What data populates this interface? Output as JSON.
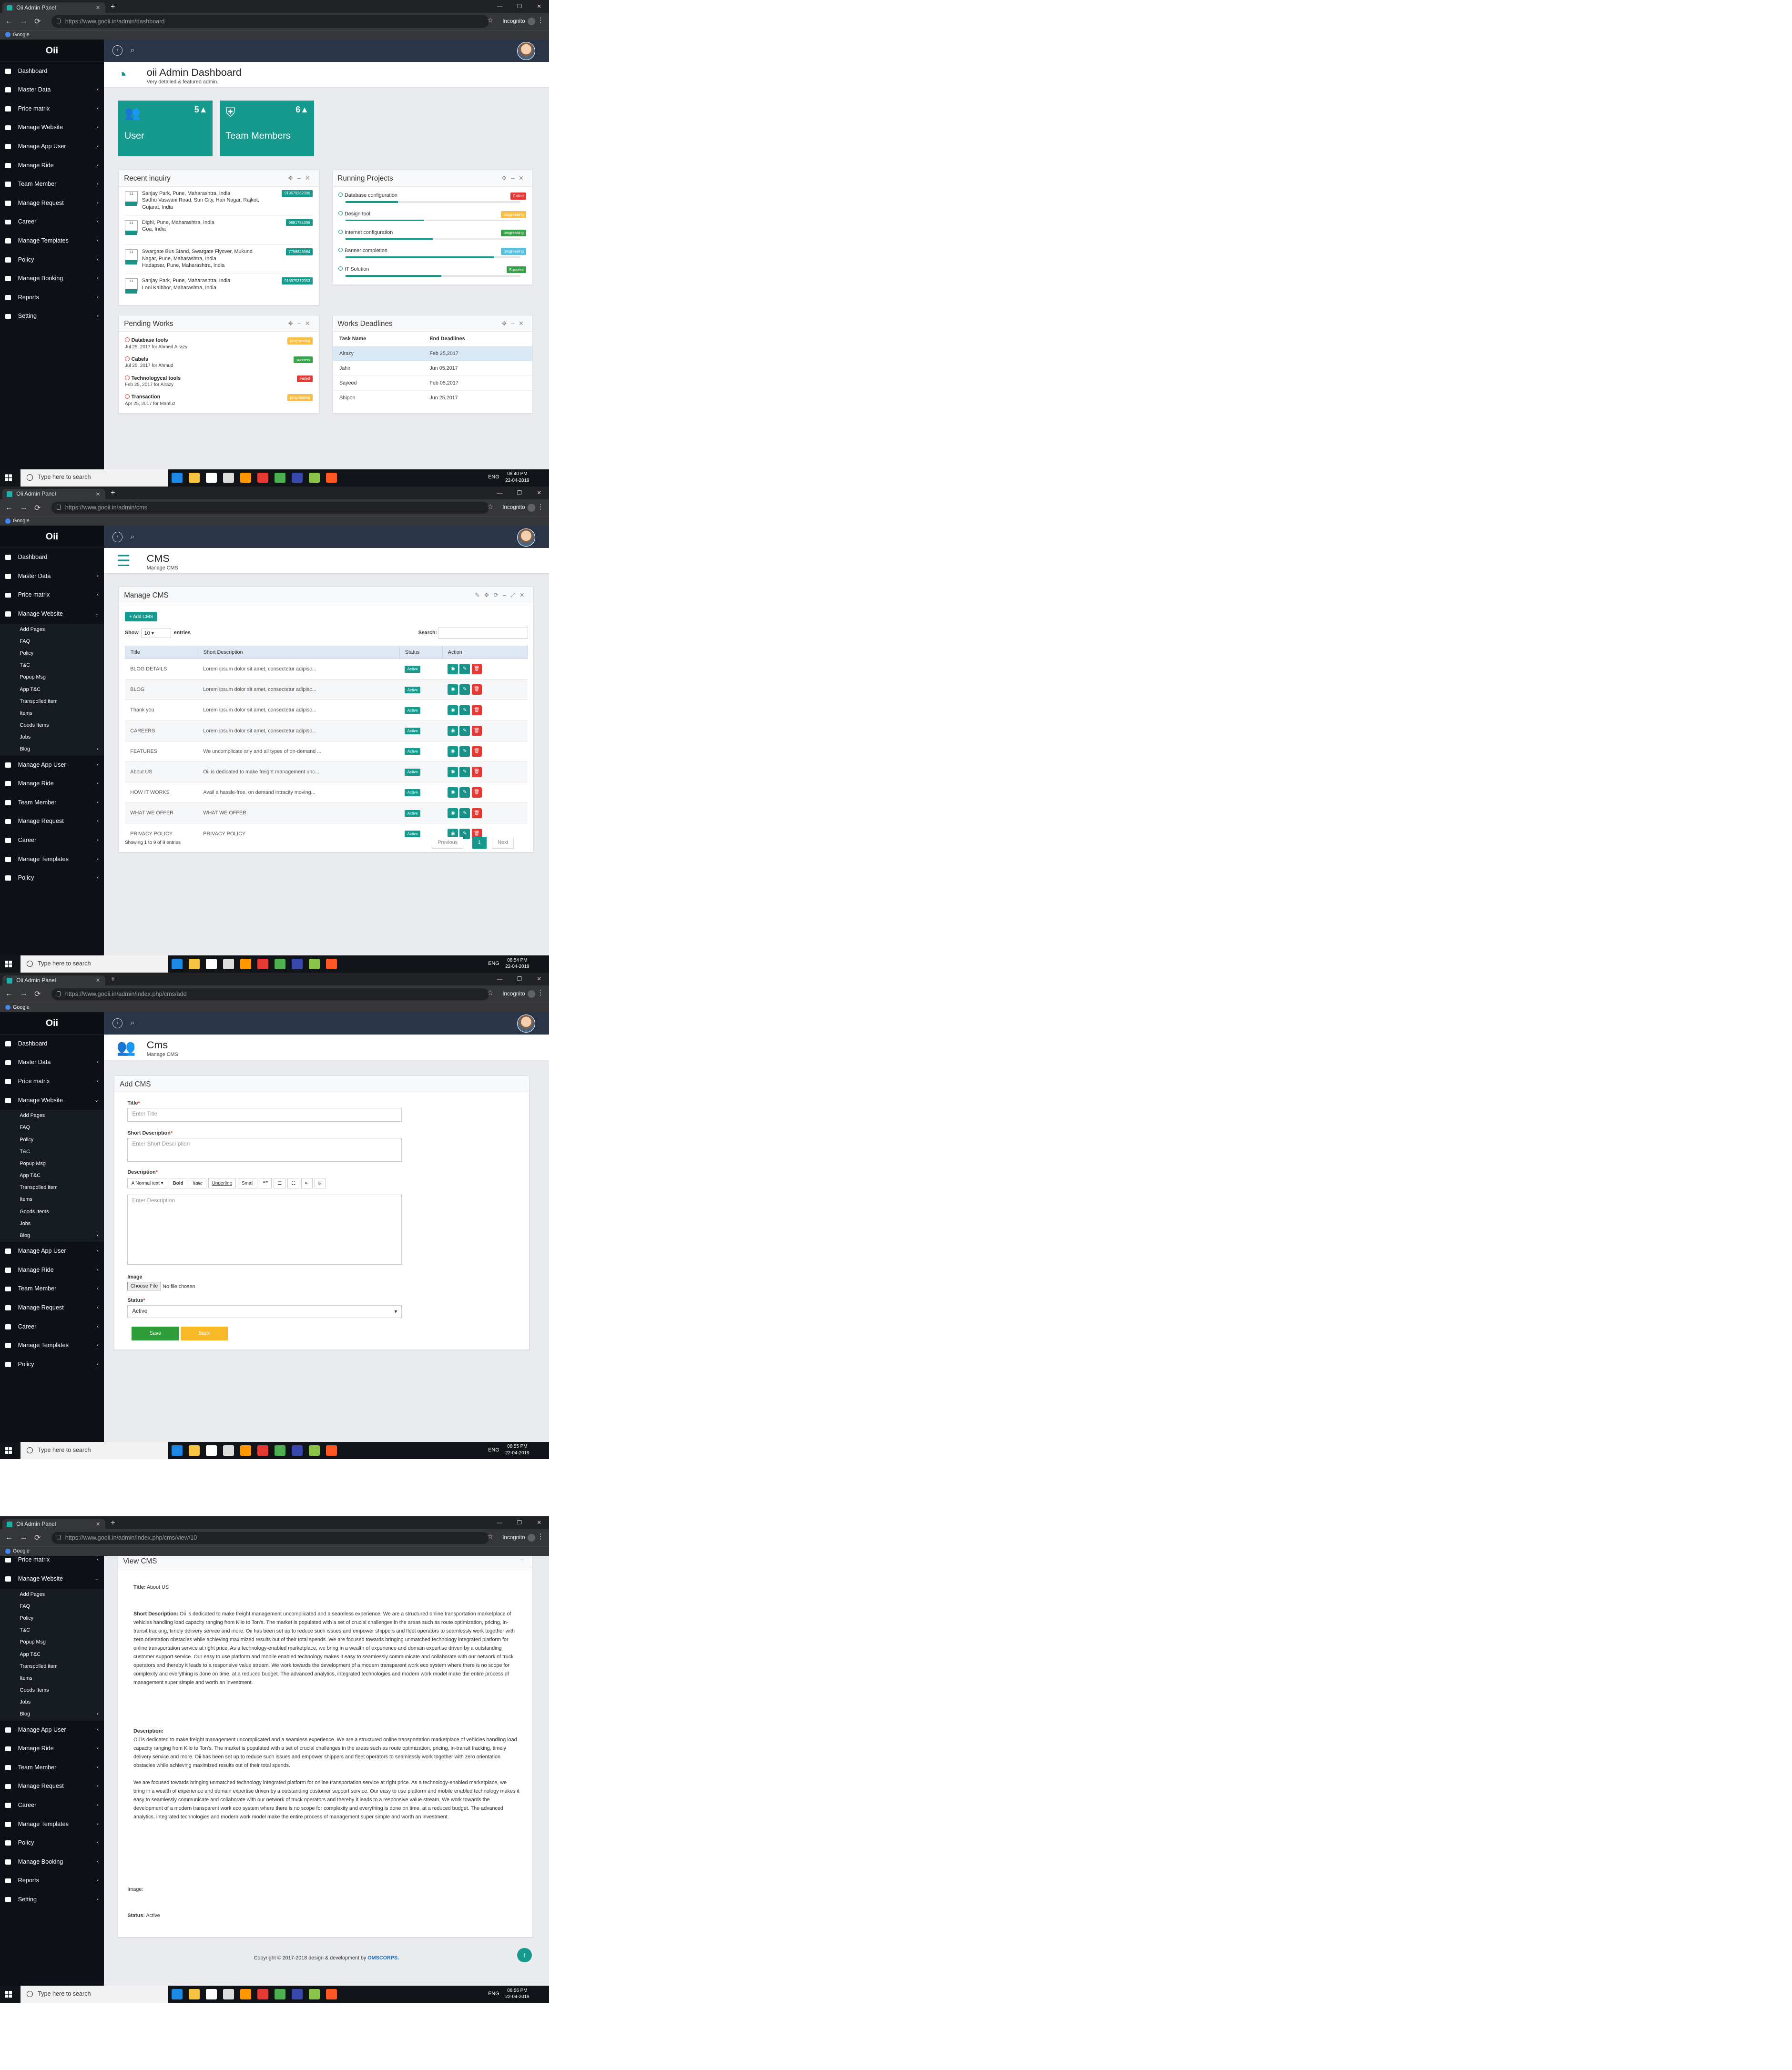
{
  "browser": {
    "tab_title": "Oii Admin Panel",
    "incognito_label": "Incognito",
    "bookmark": "Google",
    "urls": [
      "https://www.gooii.in/admin/dashboard",
      "https://www.gooii.in/admin/cms",
      "https://www.gooii.in/admin/index.php/cms/add",
      "https://www.gooii.in/admin/index.php/cms/view/10"
    ]
  },
  "brand": "Oii",
  "sidebar_main": [
    "Dashboard",
    "Master Data",
    "Price matrix",
    "Manage Website",
    "Manage App User",
    "Manage Ride",
    "Team Member",
    "Manage Request",
    "Career",
    "Manage Templates",
    "Policy",
    "Manage Booking",
    "Reports",
    "Setting"
  ],
  "sidebar_sub": [
    "Add Pages",
    "FAQ",
    "Policy",
    "T&C",
    "Popup Msg",
    "App T&C",
    "Transpolled item",
    "Items",
    "Goods Items",
    "Jobs",
    "Blog"
  ],
  "dashboard": {
    "title": "oii Admin Dashboard",
    "subtitle": "Very detailed & featured admin.",
    "stats": [
      {
        "label": "User",
        "value": "5▲"
      },
      {
        "label": "Team Members",
        "value": "6▲"
      }
    ],
    "recent_inquiry": {
      "title": "Recent inquiry",
      "items": [
        {
          "text": "Sanjay Park, Pune, Maharashtra, India",
          "sub": "Sadhu Vaswani Road, Sun City, Hari Nagar, Rajkot, Gujarat, India",
          "phone": "919579282396"
        },
        {
          "text": "Dighi, Pune, Maharashtra, India",
          "sub": "Goa, India",
          "phone": "9881784396"
        },
        {
          "text": "Swargate Bus Stand, Swargate Flyover, Mukund Nagar, Pune, Maharashtra, India",
          "sub": "Hadapsar, Pune, Maharashtra, India",
          "phone": "7798823984"
        },
        {
          "text": "Sanjay Park, Pune, Maharashtra, India",
          "sub": "Loni Kalbhor, Maharashtra, India",
          "phone": "918975372053"
        }
      ]
    },
    "running_projects": {
      "title": "Running Projects",
      "items": [
        {
          "name": "Database configuration",
          "status": "Failed",
          "progress": 0.3,
          "cls": "b-fail"
        },
        {
          "name": "Design tool",
          "status": "progressing",
          "progress": 0.45,
          "cls": "b-prog"
        },
        {
          "name": "Internet configuration",
          "status": "progressing",
          "progress": 0.5,
          "cls": "b-succ"
        },
        {
          "name": "Banner completion",
          "status": "progressing",
          "progress": 0.85,
          "cls": "b-prog2"
        },
        {
          "name": "IT Solution",
          "status": "Success",
          "progress": 0.55,
          "cls": "b-succ"
        }
      ]
    },
    "pending_works": {
      "title": "Pending Works",
      "items": [
        {
          "name": "Database tools",
          "date": "Jul 25, 2017 for Ahmed Alrazy",
          "status": "progressing",
          "cls": "b-prog"
        },
        {
          "name": "Cabels",
          "date": "Jul 25, 2017 for Ahmud",
          "status": "success",
          "cls": "b-succ"
        },
        {
          "name": "Technologycal tools",
          "date": "Feb 25, 2017 for Alrazy",
          "status": "Failed",
          "cls": "b-fail"
        },
        {
          "name": "Transaction",
          "date": "Apr 25, 2017 for Mahfuz",
          "status": "progressing",
          "cls": "b-prog"
        }
      ]
    },
    "works_deadlines": {
      "title": "Works Deadlines",
      "headers": [
        "Task Name",
        "End Deadlines"
      ],
      "rows": [
        [
          "Alrazy",
          "Feb 25,2017"
        ],
        [
          "Jahir",
          "Jun 05,2017"
        ],
        [
          "Sayeed",
          "Feb 05,2017"
        ],
        [
          "Shipon",
          "Jun 25,2017"
        ]
      ]
    }
  },
  "cms_list": {
    "title": "CMS",
    "subtitle": "Manage CMS",
    "panel_title": "Manage CMS",
    "add_button": "+ Add CMS",
    "show_label": "Show",
    "entries_value": "10",
    "entries_label": "entries",
    "search_label": "Search:",
    "headers": [
      "Title",
      "Short Description",
      "Status",
      "Action"
    ],
    "rows": [
      [
        "BLOG DETAILS",
        "Lorem ipsum dolor sit amet, consectetur adipisc..."
      ],
      [
        "BLOG",
        "Lorem ipsum dolor sit amet, consectetur adipisc..."
      ],
      [
        "Thank you",
        "Lorem ipsum dolor sit amet, consectetur adipisc..."
      ],
      [
        "CAREERS",
        "Lorem ipsum dolor sit amet, consectetur adipisc..."
      ],
      [
        "FEATURES",
        "We uncomplicate any and all types of on-demand ..."
      ],
      [
        "About US",
        "Oii is dedicated to make freight management unc..."
      ],
      [
        "HOW IT WORKS",
        "Avail a hassle-free, on demand intracity moving..."
      ],
      [
        "WHAT WE OFFER",
        "WHAT WE OFFER"
      ],
      [
        "PRIVACY POLICY",
        "PRIVACY POLICY"
      ]
    ],
    "status": "Active",
    "info": "Showing 1 to 9 of 9 entries",
    "prev": "Previous",
    "page": "1",
    "next": "Next"
  },
  "cms_add": {
    "title": "Cms",
    "subtitle": "Manage CMS",
    "panel_title": "Add CMS",
    "title_label": "Title",
    "title_placeholder": "Enter Title",
    "short_label": "Short Description",
    "short_placeholder": "Enter Short Description",
    "desc_label": "Description",
    "desc_placeholder": "Enter Description",
    "toolbar": [
      "A Normal text ▾",
      "Bold",
      "Italic",
      "Underline",
      "Small",
      "❝❞",
      "☰",
      "☷",
      "⇤",
      "⎘"
    ],
    "image_label": "Image",
    "choose_file": "Choose File",
    "no_file": "No file chosen",
    "status_label": "Status",
    "status_value": "Active",
    "save": "Save",
    "back": "Back"
  },
  "cms_view": {
    "panel_title": "View CMS",
    "title_label": "Title:",
    "title_value": "About US",
    "short_label": "Short Description:",
    "short_text": "Oii is dedicated to make freight management uncomplicated and a seamless experience. We are a structured online transportation marketplace of vehicles handling load capacity ranging from Kilo to Ton's. The market is populated with a set of crucial challenges in the areas such as route optimization, pricing, in-transit tracking, timely delivery service and more. Oii has been set up to reduce such issues and empower shippers and fleet operators to seamlessly work together with zero orientation obstacles while achieving maximized results out of their total spends. We are focused towards bringing unmatched technology integrated platform for online transportation service at right price. As a technology-enabled marketplace, we bring in a wealth of experience and domain expertise driven by a outstanding customer support service. Our easy to use platform and mobile enabled technology makes it easy to seamlessly communicate and collaborate with our network of truck operators and thereby it leads to a responsive value stream. We work towards the development of a modern transparent work eco system where there is no scope for complexity and everything is done on time, at a reduced budget. The advanced analytics, integrated technologies and modern work model make the entire process of management super simple and worth an investment.",
    "desc_label": "Description:",
    "desc_text1": "Oii is dedicated to make freight management uncomplicated and a seamless experience. We are a structured online transportation marketplace of vehicles handling load capacity ranging from Kilo to Ton's. The market is populated with a set of crucial challenges in the areas such as route optimization, pricing, in-transit tracking, timely delivery service and more. Oii has been set up to reduce such issues and empower shippers and fleet operators to seamlessly work together with zero orientation obstacles while achieving maximized results out of their total spends.",
    "desc_text2": "We are focused towards bringing unmatched technology integrated platform for online transportation service at right price. As a technology-enabled marketplace, we bring in a wealth of experience and domain expertise driven by a outstanding customer support service. Our easy to use platform and mobile enabled technology makes it easy to seamlessly communicate and collaborate with our network of truck operators and thereby it leads to a responsive value stream. We work towards the development of a modern transparent work eco system where there is no scope for complexity and everything is done on time, at a reduced budget. The advanced analytics, integrated technologies and modern work model make the entire process of management super simple and worth an investment.",
    "image_label": "Image:",
    "status_label": "Status:",
    "status_value": "Active",
    "footer": "Copyright © 2017-2018 design & development by",
    "footer_brand": "OMSCORPS."
  },
  "taskbar": {
    "search": "Type here to search",
    "lang": "ENG",
    "times": [
      "08:40 PM",
      "08:54 PM",
      "08:55 PM",
      "08:56 PM"
    ],
    "date": "22-04-2019"
  }
}
